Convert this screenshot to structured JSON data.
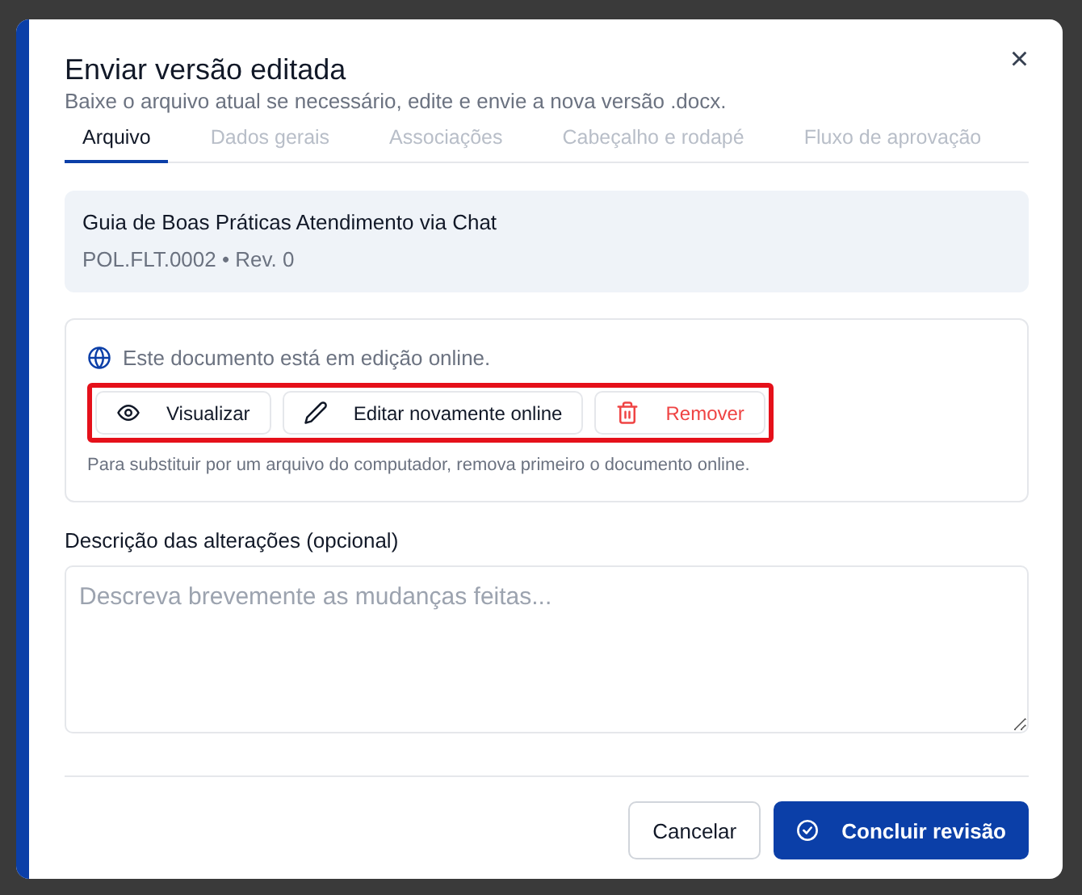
{
  "dialog": {
    "title": "Enviar versão editada",
    "subtitle": "Baixe o arquivo atual se necessário, edite e envie a nova versão .docx.",
    "close_label": "×"
  },
  "tabs": [
    {
      "label": "Arquivo",
      "selected": true
    },
    {
      "label": "Dados gerais",
      "selected": false
    },
    {
      "label": "Associações",
      "selected": false
    },
    {
      "label": "Cabeçalho e rodapé",
      "selected": false
    },
    {
      "label": "Fluxo de aprovação",
      "selected": false
    }
  ],
  "document": {
    "name": "Guia de Boas Práticas Atendimento via Chat",
    "meta": "POL.FLT.0002 • Rev. 0"
  },
  "online_panel": {
    "status": "Este documento está em edição online.",
    "highlighted": true,
    "actions": [
      {
        "kind": "view",
        "label": "Visualizar"
      },
      {
        "kind": "edit",
        "label": "Editar novamente online"
      },
      {
        "kind": "remove",
        "label": "Remover"
      }
    ],
    "hint": "Para substituir por um arquivo do computador, remova primeiro o documento online."
  },
  "description": {
    "label": "Descrição das alterações (opcional)",
    "placeholder": "Descreva brevemente as mudanças feitas..."
  },
  "footer": {
    "cancel": "Cancelar",
    "confirm": "Concluir revisão"
  }
}
